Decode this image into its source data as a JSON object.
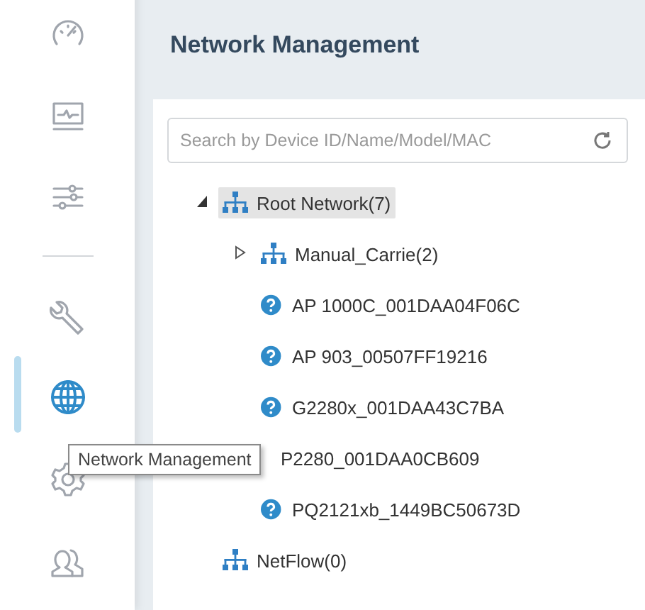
{
  "sidebar": {
    "items": [
      {
        "selected": false
      },
      {
        "selected": false
      },
      {
        "selected": false
      },
      {
        "selected": false
      },
      {
        "selected": true
      },
      {
        "selected": false
      },
      {
        "selected": false
      }
    ]
  },
  "tooltip": {
    "text": "Network Management"
  },
  "header": {
    "title": "Network Management"
  },
  "search": {
    "placeholder": "Search by Device ID/Name/Model/MAC"
  },
  "tree": [
    {
      "kind": "group",
      "label": "Root Network(7)",
      "expanded": true,
      "selected": true,
      "children": [
        {
          "kind": "group",
          "label": "Manual_Carrie(2)",
          "expanded": false,
          "selected": false
        },
        {
          "kind": "device",
          "label": "AP 1000C_001DAA04F06C",
          "selected": false
        },
        {
          "kind": "device",
          "label": "AP 903_00507FF19216",
          "selected": false
        },
        {
          "kind": "device",
          "label": "G2280x_001DAA43C7BA",
          "selected": false
        },
        {
          "kind": "covered",
          "label": "P2280_001DAA0CB609",
          "selected": false
        },
        {
          "kind": "device",
          "label": "PQ2121xb_1449BC50673D",
          "selected": false
        }
      ]
    },
    {
      "kind": "group",
      "label": "NetFlow(0)",
      "selected": false
    }
  ]
}
